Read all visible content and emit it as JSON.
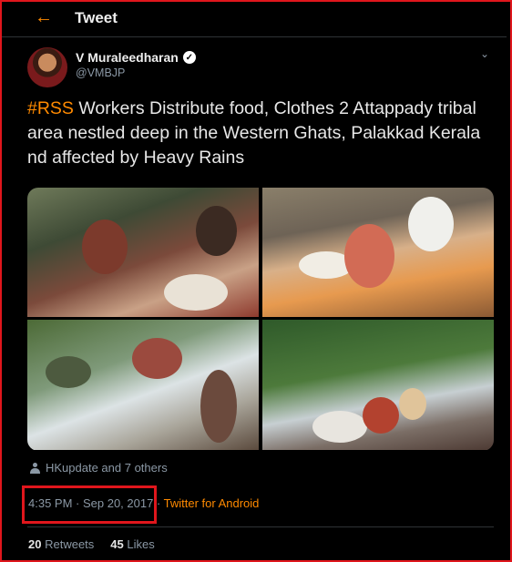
{
  "header": {
    "title": "Tweet",
    "back_icon": "←"
  },
  "author": {
    "name": "V Muraleedharan",
    "handle": "@VMBJP",
    "verified_icon": "✓",
    "menu_icon": "⌄"
  },
  "tweet": {
    "hashtag": "#RSS",
    "text": " Workers Distribute food, Clothes 2 Attappady tribal area nestled deep in the Western Ghats, Palakkad Kerala nd affected by Heavy Rains"
  },
  "retweeted_by": "HKupdate and 7 others",
  "meta": {
    "time": "4:35 PM · Sep 20, 2017",
    "separator": " · ",
    "app": "Twitter for Android"
  },
  "stats": {
    "retweets_count": "20",
    "retweets_label": "Retweets",
    "likes_count": "45",
    "likes_label": "Likes"
  },
  "colors": {
    "accent": "#ff8a00",
    "highlight": "#e0161c",
    "background": "#000000"
  }
}
